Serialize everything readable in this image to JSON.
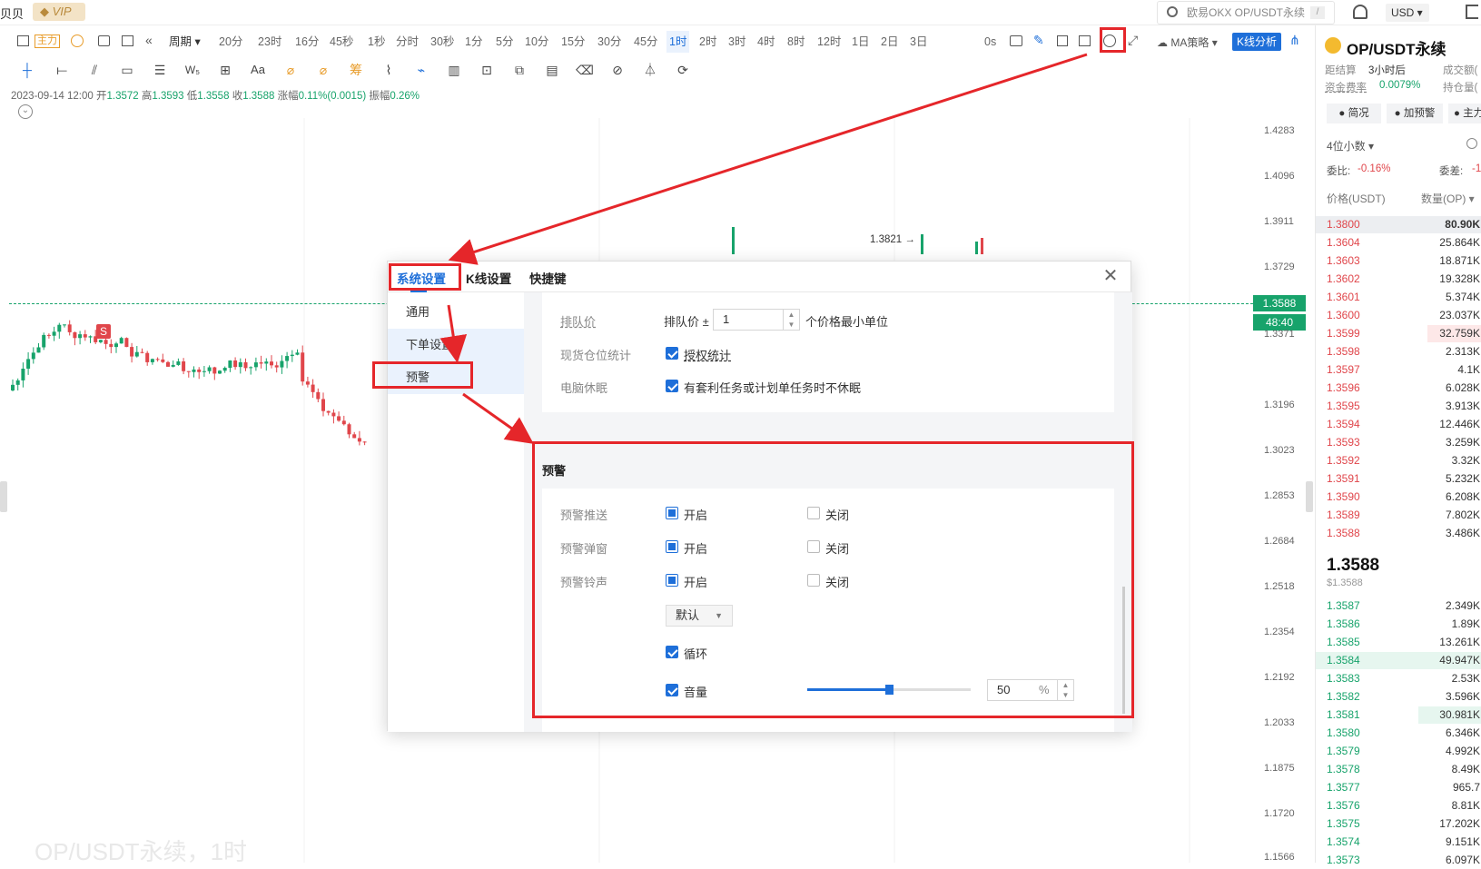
{
  "topbar": {
    "brand": "贝贝",
    "vip": "VIP",
    "search_placeholder": "欧易OKX OP/USDT永续",
    "search_shortcut": "/",
    "currency": "USD ▾"
  },
  "toolbar": {
    "main_label": "主力",
    "period_label": "周期",
    "periods": [
      "20分",
      "23时",
      "16分",
      "45秒",
      "1秒",
      "分时",
      "30秒",
      "1分",
      "5分",
      "10分",
      "15分",
      "30分",
      "45分",
      "1时",
      "2时",
      "3时",
      "4时",
      "8时",
      "12时",
      "1日",
      "2日",
      "3日"
    ],
    "active_period": "1时",
    "zero_s": "0s",
    "ma_strategy": "MA策略",
    "k_analysis": "K线分析"
  },
  "ohlc": {
    "date": "2023-09-14 12:00",
    "open_label": "开",
    "open": "1.3572",
    "high_label": "高",
    "high": "1.3593",
    "low_label": "低",
    "low": "1.3558",
    "close_label": "收",
    "close": "1.3588",
    "change_label": "涨幅",
    "change": "0.11%(0.0015)",
    "amp_label": "振幅",
    "amp": "0.26%"
  },
  "chart": {
    "y_ticks": [
      "1.4283",
      "1.4096",
      "1.3911",
      "1.3729",
      "1.3588",
      "1.3371",
      "1.3196",
      "1.3023",
      "1.2853",
      "1.2684",
      "1.2518",
      "1.2354",
      "1.2192",
      "1.2033",
      "1.1875",
      "1.1720",
      "1.1566"
    ],
    "current_price": "1.3588",
    "countdown": "48:40",
    "peak_label": "1.3821 →",
    "signal": "S",
    "watermark": "OP/USDT永续，1时"
  },
  "orderbook": {
    "symbol": "OP/USDT永续",
    "settle_label": "距结算",
    "settle_value": "3小时后",
    "volume_label": "成交额(",
    "funding_label": "资金费率",
    "funding_value": "0.0079%",
    "oi_label": "持仓量(",
    "btn_brief": "简况",
    "btn_alert": "加预警",
    "btn_main": "主力",
    "decimals": "4位小数 ▾",
    "ratio_label": "委比:",
    "ratio_value": "-0.16%",
    "diff_label": "委差:",
    "diff_value": "-1",
    "col_price": "价格(USDT)",
    "col_qty": "数量(OP) ▾",
    "asks": [
      {
        "p": "1.3800",
        "q": "80.90K"
      },
      {
        "p": "1.3604",
        "q": "25.864K"
      },
      {
        "p": "1.3603",
        "q": "18.871K"
      },
      {
        "p": "1.3602",
        "q": "19.328K"
      },
      {
        "p": "1.3601",
        "q": "5.374K"
      },
      {
        "p": "1.3600",
        "q": "23.037K"
      },
      {
        "p": "1.3599",
        "q": "32.759K"
      },
      {
        "p": "1.3598",
        "q": "2.313K"
      },
      {
        "p": "1.3597",
        "q": "4.1K"
      },
      {
        "p": "1.3596",
        "q": "6.028K"
      },
      {
        "p": "1.3595",
        "q": "3.913K"
      },
      {
        "p": "1.3594",
        "q": "12.446K"
      },
      {
        "p": "1.3593",
        "q": "3.259K"
      },
      {
        "p": "1.3592",
        "q": "3.32K"
      },
      {
        "p": "1.3591",
        "q": "5.232K"
      },
      {
        "p": "1.3590",
        "q": "6.208K"
      },
      {
        "p": "1.3589",
        "q": "7.802K"
      },
      {
        "p": "1.3588",
        "q": "3.486K"
      }
    ],
    "last_price": "1.3588",
    "last_usd": "$1.3588",
    "bids": [
      {
        "p": "1.3587",
        "q": "2.349K"
      },
      {
        "p": "1.3586",
        "q": "1.89K"
      },
      {
        "p": "1.3585",
        "q": "13.261K"
      },
      {
        "p": "1.3584",
        "q": "49.947K"
      },
      {
        "p": "1.3583",
        "q": "2.53K"
      },
      {
        "p": "1.3582",
        "q": "3.596K"
      },
      {
        "p": "1.3581",
        "q": "30.981K"
      },
      {
        "p": "1.3580",
        "q": "6.346K"
      },
      {
        "p": "1.3579",
        "q": "4.992K"
      },
      {
        "p": "1.3578",
        "q": "8.49K"
      },
      {
        "p": "1.3577",
        "q": "965.7"
      },
      {
        "p": "1.3576",
        "q": "8.81K"
      },
      {
        "p": "1.3575",
        "q": "17.202K"
      },
      {
        "p": "1.3574",
        "q": "9.151K"
      },
      {
        "p": "1.3573",
        "q": "6.097K"
      }
    ]
  },
  "modal": {
    "tabs": [
      "系统设置",
      "K线设置",
      "快捷键"
    ],
    "nav": [
      "通用",
      "下单设置",
      "预警"
    ],
    "queue_label": "排队价",
    "queue_prefix": "排队价 ±",
    "queue_value": "1",
    "queue_suffix": "个价格最小单位",
    "spot_label": "现货仓位统计",
    "spot_option": "授权统计",
    "sleep_label": "电脑休眠",
    "sleep_option": "有套利任务或计划单任务时不休眠",
    "alert_section": "预警",
    "push_label": "预警推送",
    "popup_label": "预警弹窗",
    "sound_label": "预警铃声",
    "on": "开启",
    "off": "关闭",
    "sound_select": "默认",
    "loop": "循环",
    "volume": "音量",
    "volume_value": "50",
    "volume_unit": "%"
  }
}
